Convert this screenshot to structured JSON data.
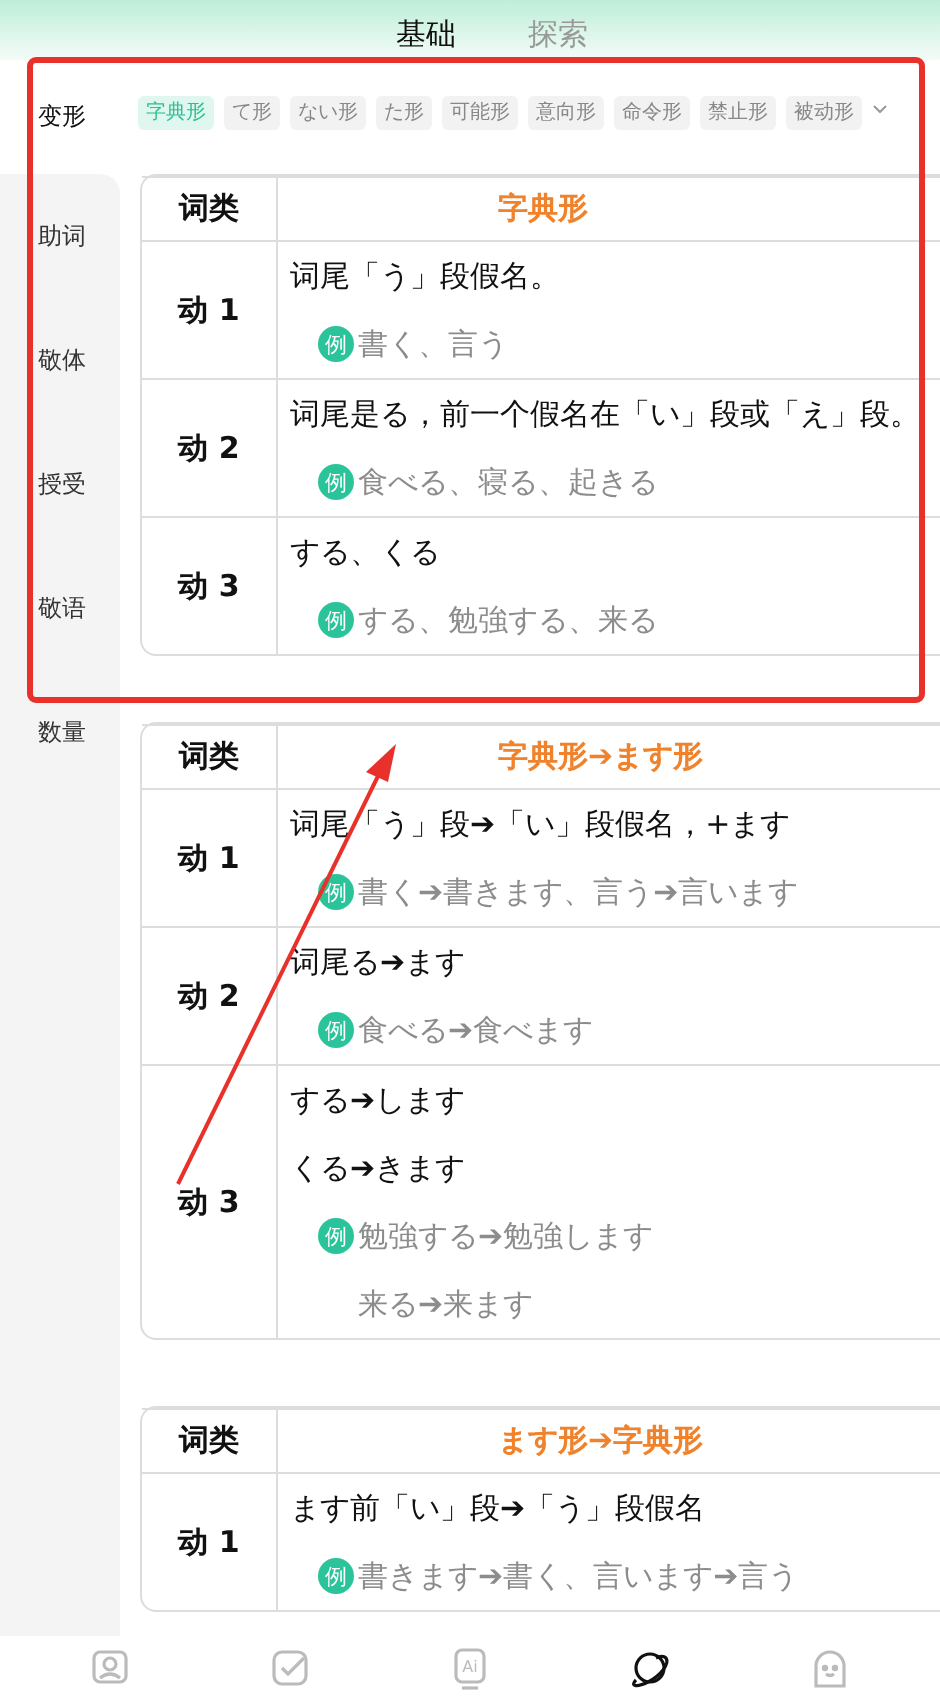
{
  "tabs": [
    {
      "label": "基础",
      "selected": true
    },
    {
      "label": "探索",
      "selected": false
    }
  ],
  "sidebar": [
    {
      "label": "变形",
      "selected": true
    },
    {
      "label": "助词",
      "selected": false
    },
    {
      "label": "敬体",
      "selected": false
    },
    {
      "label": "授受",
      "selected": false
    },
    {
      "label": "敬语",
      "selected": false
    },
    {
      "label": "数量",
      "selected": false
    }
  ],
  "chips": [
    {
      "label": "字典形",
      "selected": true
    },
    {
      "label": "て形",
      "selected": false
    },
    {
      "label": "ない形",
      "selected": false
    },
    {
      "label": "た形",
      "selected": false
    },
    {
      "label": "可能形",
      "selected": false
    },
    {
      "label": "意向形",
      "selected": false
    },
    {
      "label": "命令形",
      "selected": false
    },
    {
      "label": "禁止形",
      "selected": false
    },
    {
      "label": "被动形",
      "selected": false
    }
  ],
  "tables": [
    {
      "column_1": "词类",
      "column_2": "字典形",
      "rows": [
        {
          "category": "动 1",
          "lines": [
            {
              "kind": "rule",
              "text": "词尾「う」段假名。"
            },
            {
              "kind": "example",
              "badge": "例",
              "text": "書く、言う"
            }
          ]
        },
        {
          "category": "动 2",
          "lines": [
            {
              "kind": "rule",
              "text": "词尾是る，前一个假名在「い」段或「え」段。"
            },
            {
              "kind": "example",
              "badge": "例",
              "text": "食べる、寝る、起きる"
            }
          ]
        },
        {
          "category": "动 3",
          "lines": [
            {
              "kind": "rule",
              "text": "する、くる"
            },
            {
              "kind": "example",
              "badge": "例",
              "text": "する、勉強する、来る"
            }
          ]
        }
      ]
    },
    {
      "column_1": "词类",
      "column_2": "字典形➔ます形",
      "rows": [
        {
          "category": "动 1",
          "lines": [
            {
              "kind": "rule",
              "text": "词尾「う」段➔「い」段假名，+ます"
            },
            {
              "kind": "example",
              "badge": "例",
              "text": "書く➔書きます、言う➔言います"
            }
          ]
        },
        {
          "category": "动 2",
          "lines": [
            {
              "kind": "rule",
              "text": "词尾る➔ます"
            },
            {
              "kind": "example",
              "badge": "例",
              "text": "食べる➔食べます"
            }
          ]
        },
        {
          "category": "动 3",
          "lines": [
            {
              "kind": "rule",
              "text": "する➔します"
            },
            {
              "kind": "rule",
              "text": "くる➔きます"
            },
            {
              "kind": "example",
              "badge": "例",
              "text": "勉強する➔勉強します"
            },
            {
              "kind": "continuation",
              "text": "来る➔来ます"
            }
          ]
        }
      ]
    },
    {
      "column_1": "词类",
      "column_2": "ます形➔字典形",
      "rows": [
        {
          "category": "动 1",
          "lines": [
            {
              "kind": "rule",
              "text": "ます前「い」段➔「う」段假名"
            },
            {
              "kind": "example",
              "badge": "例",
              "text": "書きます➔書く、言います➔言う"
            }
          ]
        }
      ]
    }
  ],
  "bottom_nav": [
    {
      "kind": "photo",
      "selected": false
    },
    {
      "kind": "check",
      "selected": false
    },
    {
      "kind": "ai",
      "glyph": "Ai",
      "selected": false
    },
    {
      "kind": "planet",
      "selected": true
    },
    {
      "kind": "face",
      "selected": false
    }
  ],
  "annotations": {
    "highlight_frame": true,
    "pointer_arrow": true
  }
}
